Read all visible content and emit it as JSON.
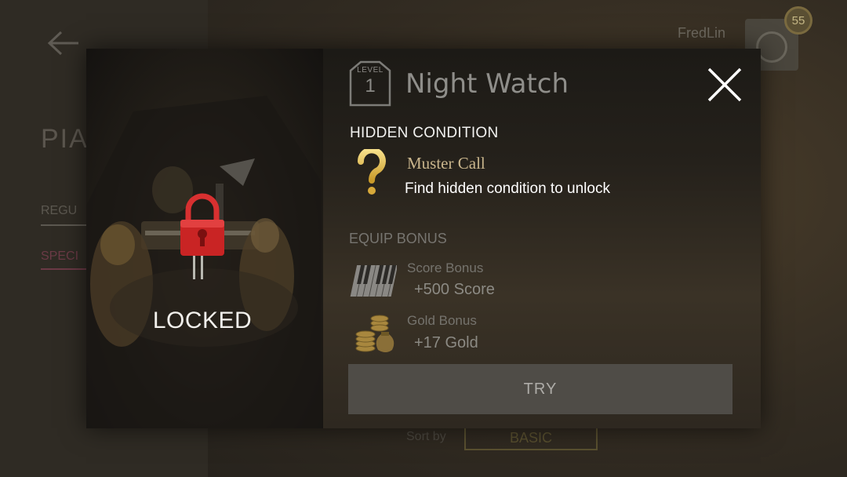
{
  "background": {
    "title": "PIA",
    "tabs": [
      "REGU",
      "SPECI"
    ],
    "username": "FredLin",
    "user_level": "55",
    "sort_label": "Sort by",
    "sort_value": "BASIC"
  },
  "modal": {
    "level_label": "LEVEL",
    "level_number": "1",
    "title": "Night Watch",
    "status": "LOCKED",
    "hidden_condition": {
      "heading": "HIDDEN CONDITION",
      "name": "Muster Call",
      "description": "Find hidden condition to unlock",
      "icon": "question-mark-icon"
    },
    "equip_bonus": {
      "heading": "EQUIP BONUS",
      "items": [
        {
          "label": "Score Bonus",
          "value": "+500 Score",
          "icon": "piano-keys-icon"
        },
        {
          "label": "Gold Bonus",
          "value": "+17 Gold",
          "icon": "gold-coins-icon"
        }
      ]
    },
    "try_button": "TRY"
  },
  "colors": {
    "accent_gold": "#c9b58c",
    "lock_red": "#d42a2a",
    "button_bg": "#4f4c47"
  }
}
